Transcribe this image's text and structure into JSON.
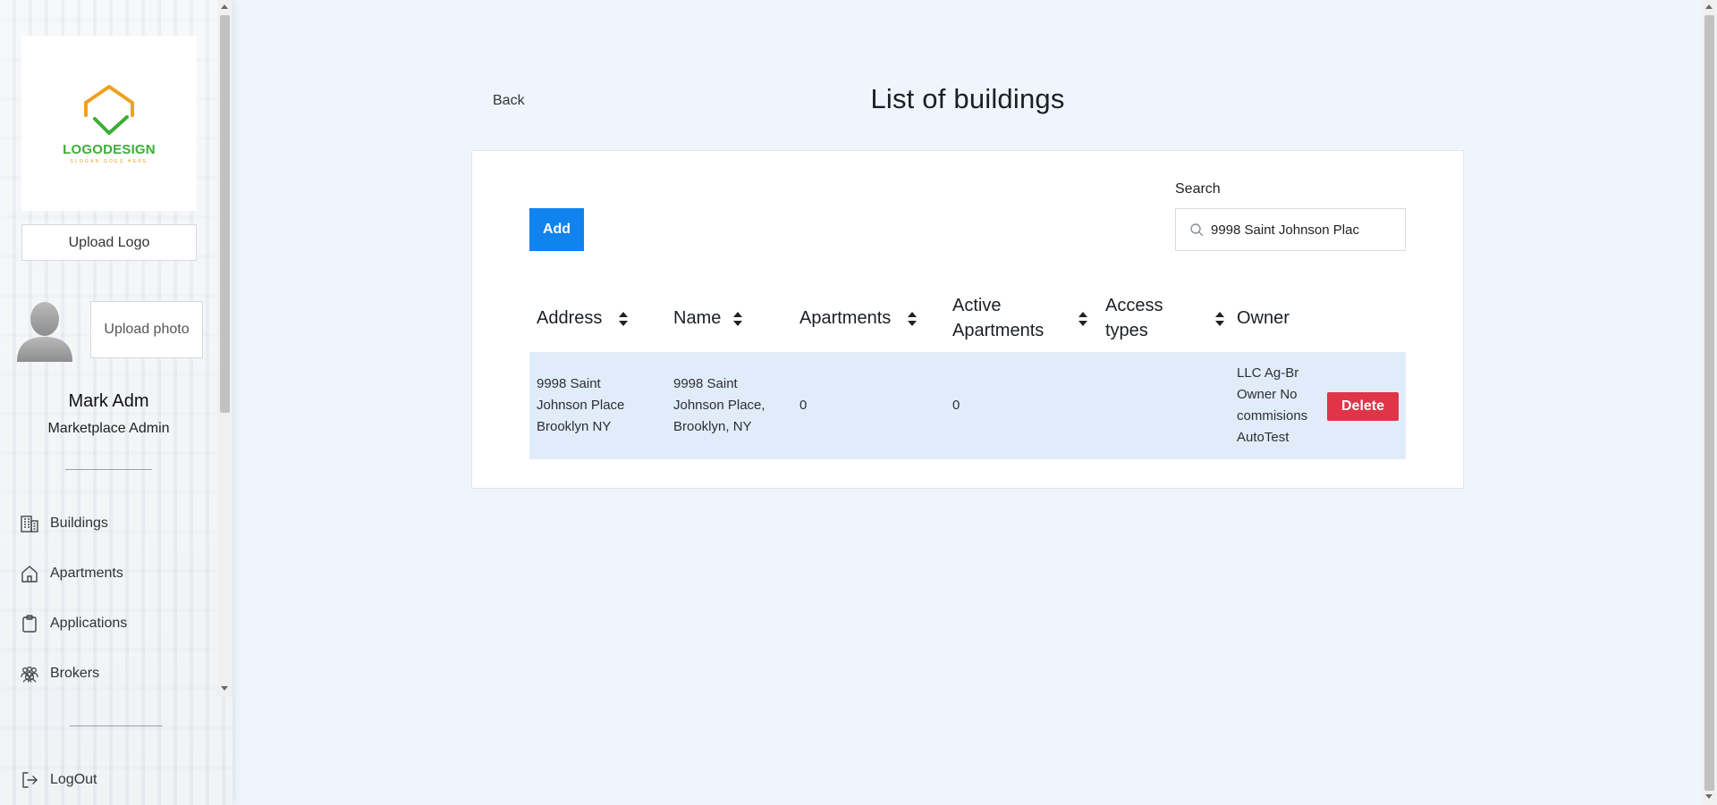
{
  "sidebar": {
    "logo": {
      "text": "LOGODESIGN",
      "slogan": "SLOGAN GOES HERE"
    },
    "upload_logo_label": "Upload Logo",
    "upload_photo_label": "Upload photo",
    "user": {
      "name": "Mark Adm",
      "role": "Marketplace Admin"
    },
    "nav": [
      {
        "label": "Buildings",
        "icon": "building-icon"
      },
      {
        "label": "Apartments",
        "icon": "home-icon"
      },
      {
        "label": "Applications",
        "icon": "clipboard-icon"
      },
      {
        "label": "Brokers",
        "icon": "users-icon"
      }
    ],
    "logout_label": "LogOut"
  },
  "header": {
    "back_label": "Back",
    "title": "List of buildings"
  },
  "toolbar": {
    "add_label": "Add",
    "search_label": "Search",
    "search_value": "9998 Saint Johnson Plac"
  },
  "table": {
    "columns": [
      {
        "label": "Address",
        "sortable": true
      },
      {
        "label": "Name",
        "sortable": true
      },
      {
        "label": "Apartments",
        "sortable": true
      },
      {
        "label": "Active Apartments",
        "sortable": true
      },
      {
        "label": "Access types",
        "sortable": true
      },
      {
        "label": "Owner",
        "sortable": false
      }
    ],
    "rows": [
      {
        "address": "9998 Saint Johnson Place Brooklyn NY",
        "name": "9998 Saint Johnson Place, Brooklyn, NY",
        "apartments": "0",
        "active_apartments": "0",
        "access_types": "",
        "owner": "LLC Ag-Br Owner No commisions AutoTest",
        "delete_label": "Delete"
      }
    ]
  },
  "colors": {
    "accent": "#1083ef",
    "danger": "#e03448",
    "row_highlight": "#e1ecfa",
    "page_bg": "#eef5fd",
    "logo_green": "#3cae36",
    "logo_orange": "#f0a020"
  }
}
